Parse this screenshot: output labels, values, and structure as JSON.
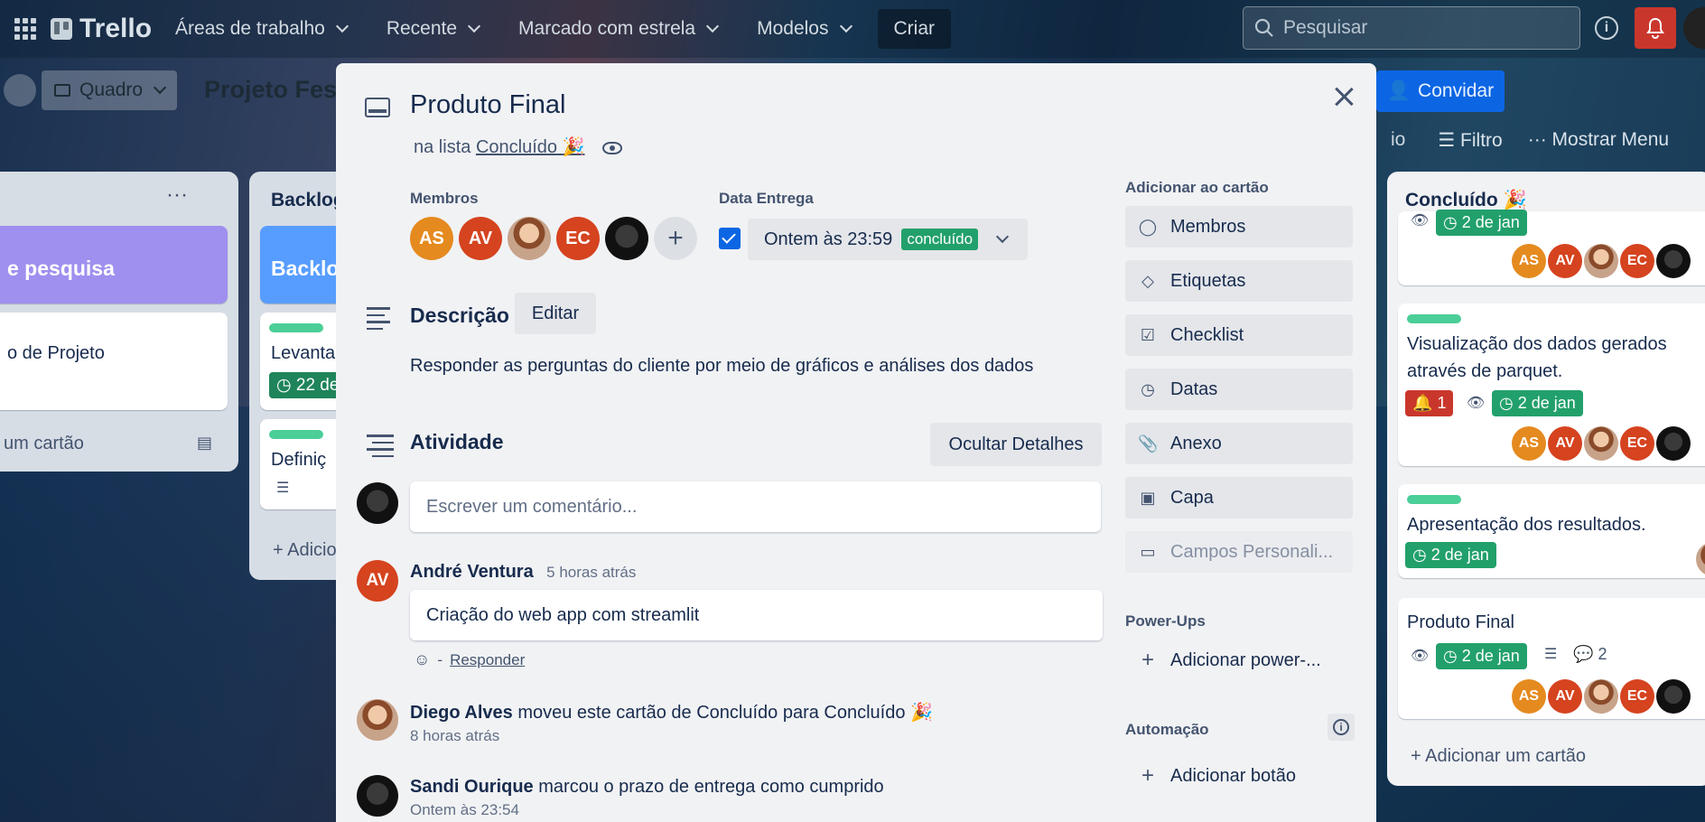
{
  "topnav": {
    "brand": "Trello",
    "menu": [
      "Áreas de trabalho",
      "Recente",
      "Marcado com estrela",
      "Modelos"
    ],
    "create": "Criar",
    "search_placeholder": "Pesquisar"
  },
  "board": {
    "view": "Quadro",
    "title": "Projeto Fest",
    "invite": "Convidar",
    "filter_partial": "io",
    "filter": "Filtro",
    "show_menu": "Mostrar Menu"
  },
  "left_lists": {
    "list1": {
      "card_title": "e pesquisa",
      "card2": "o de Projeto",
      "add": "um cartão"
    },
    "list2": {
      "title": "Backlog",
      "card_title": "Backlo",
      "card1": "Levanta",
      "card1_badge": "22 de",
      "card2": "Definiç",
      "add": "Adicio"
    }
  },
  "modal": {
    "title": "Produto Final",
    "in_list_prefix": "na lista",
    "in_list_name": "Concluído",
    "members_label": "Membros",
    "members": [
      "AS",
      "AV",
      "",
      "EC",
      ""
    ],
    "due_label": "Data Entrega",
    "due_value": "Ontem às 23:59",
    "due_status": "concluído",
    "description_heading": "Descrição",
    "edit": "Editar",
    "description": "Responder as perguntas do cliente por meio de gráficos e análises dos dados",
    "activity_heading": "Atividade",
    "hide_details": "Ocultar Detalhes",
    "comment_placeholder": "Escrever um comentário...",
    "comments": [
      {
        "initials": "AV",
        "author": "André Ventura",
        "time": "5 horas atrás",
        "text": "Criação do web app com streamlit",
        "reply": "Responder",
        "separator": "-"
      }
    ],
    "activities": [
      {
        "author": "Diego Alves",
        "text": "moveu este cartão de Concluído para Concluído",
        "time": "8 horas atrás"
      },
      {
        "author": "Sandi Ourique",
        "text": "marcou o prazo de entrega como cumprido",
        "time": "Ontem às 23:54"
      }
    ],
    "sidebar": {
      "add_to_card": "Adicionar ao cartão",
      "buttons": [
        "Membros",
        "Etiquetas",
        "Checklist",
        "Datas",
        "Anexo",
        "Capa",
        "Campos Personali..."
      ],
      "powerups_label": "Power-Ups",
      "add_powerup": "Adicionar power-...",
      "automation_label": "Automação",
      "add_button": "Adicionar botão"
    }
  },
  "right_list": {
    "title": "Concluído",
    "cards": [
      {
        "badge": "2 de jan",
        "members": [
          "AS",
          "AV",
          "",
          "EC"
        ]
      },
      {
        "text": "Visualização dos dados gerados através de parquet.",
        "notif": "1",
        "badge": "2 de jan",
        "members": [
          "AS",
          "AV",
          "",
          "EC"
        ]
      },
      {
        "text": "Apresentação dos resultados.",
        "badge": "2 de jan"
      },
      {
        "text": "Produto Final",
        "badge": "2 de jan",
        "comments": "2",
        "members": [
          "AS",
          "AV",
          "",
          "EC"
        ]
      }
    ],
    "add_card": "Adicionar um cartão"
  },
  "colors": {
    "accent": "#0c66e4",
    "done_green": "#22a06b",
    "label_green": "#4bce97",
    "alert_red": "#c9372c"
  }
}
